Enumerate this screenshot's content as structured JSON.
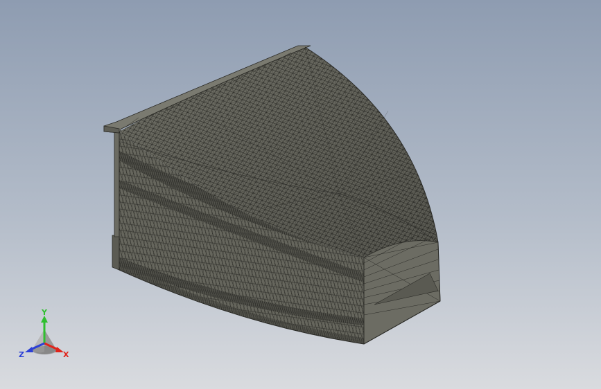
{
  "triad": {
    "x_label": "X",
    "y_label": "Y",
    "z_label": "Z",
    "x_color": "#e0241b",
    "y_color": "#2fbf2f",
    "z_color": "#2b3fd6"
  },
  "model": {
    "mesh_color": "#6f6f66",
    "mesh_line_color": "#2a2a26",
    "shade_light": "#8a8a80",
    "shade_dark": "#555550"
  }
}
